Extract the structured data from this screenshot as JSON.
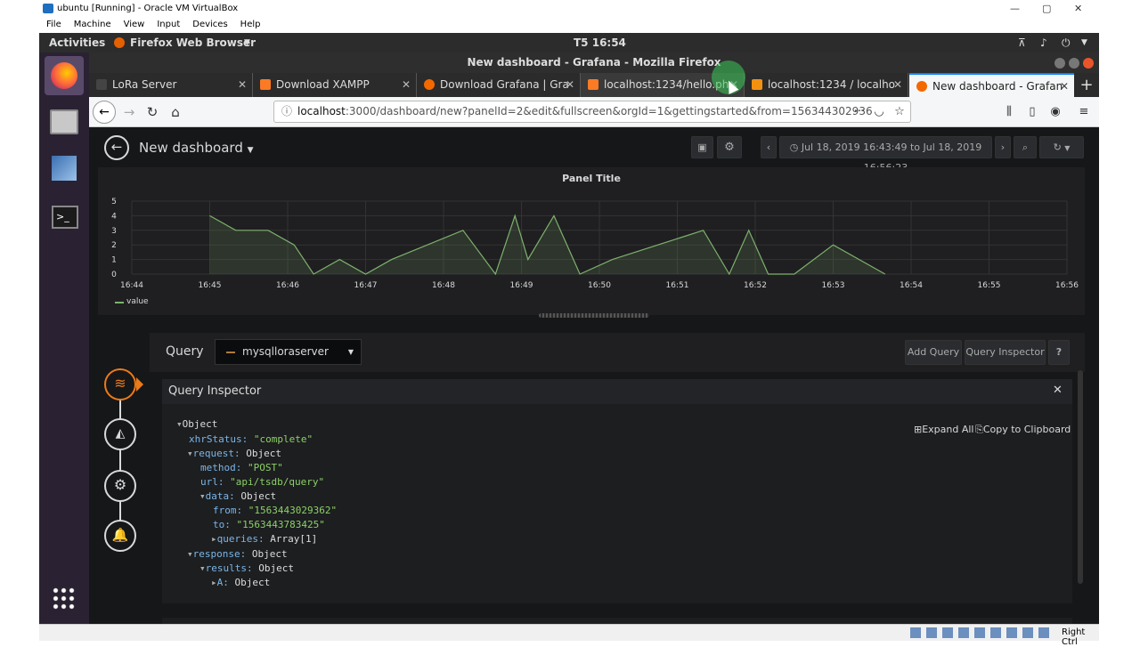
{
  "vbox": {
    "title": "ubuntu [Running] - Oracle VM VirtualBox",
    "menu": [
      "File",
      "Machine",
      "View",
      "Input",
      "Devices",
      "Help"
    ],
    "status_right": "Right Ctrl"
  },
  "ubuntu_bar": {
    "activities": "Activities",
    "app": "Firefox Web Browser",
    "clock": "T5 16:54"
  },
  "firefox": {
    "window_title": "New dashboard - Grafana - Mozilla Firefox",
    "tabs": [
      {
        "label": "LoRa Server"
      },
      {
        "label": "Download XAMPP"
      },
      {
        "label": "Download Grafana | Gra"
      },
      {
        "label": "localhost:1234/hello.ph"
      },
      {
        "label": "localhost:1234 / localho"
      },
      {
        "label": "New dashboard - Grafan"
      }
    ],
    "url_host": "localhost",
    "url_rest": ":3000/dashboard/new?panelId=2&edit&fullscreen&orgId=1&gettingstarted&from=156344302936"
  },
  "grafana": {
    "dashboard_title": "New dashboard",
    "time_range": "Jul 18, 2019 16:43:49 to Jul 18, 2019 16:56:23",
    "query_label": "Query",
    "datasource": "mysqlloraserver",
    "add_query": "Add Query",
    "query_inspector_btn": "Query Inspector",
    "help": "?",
    "inspector_title": "Query Inspector",
    "expand_all": "Expand All",
    "copy_clipboard": "Copy to Clipboard",
    "json": {
      "l1": "Object",
      "xhr_k": "xhrStatus:",
      "xhr_v": "\"complete\"",
      "req_k": "request:",
      "req_v": "Object",
      "method_k": "method:",
      "method_v": "\"POST\"",
      "url_k": "url:",
      "url_v": "\"api/tsdb/query\"",
      "data_k": "data:",
      "data_v": "Object",
      "from_k": "from:",
      "from_v": "\"1563443029362\"",
      "to_k": "to:",
      "to_v": "\"1563443783425\"",
      "queries_k": "queries:",
      "queries_v": "Array[1]",
      "resp_k": "response:",
      "resp_v": "Object",
      "results_k": "results:",
      "results_v": "Object",
      "a_k": "A:",
      "a_v": "Object"
    }
  },
  "chart_data": {
    "type": "area",
    "title": "Panel Title",
    "x_ticks": [
      "16:44",
      "16:45",
      "16:46",
      "16:47",
      "16:48",
      "16:49",
      "16:50",
      "16:51",
      "16:52",
      "16:53",
      "16:54",
      "16:55",
      "16:56"
    ],
    "y_ticks": [
      0,
      1,
      2,
      3,
      4,
      5
    ],
    "ylim": [
      0,
      5
    ],
    "series": [
      {
        "name": "value",
        "color": "#7eb26d",
        "x": [
          "16:45:00",
          "16:45:20",
          "16:45:45",
          "16:46:05",
          "16:46:20",
          "16:46:40",
          "16:47:00",
          "16:47:20",
          "16:48:15",
          "16:48:40",
          "16:48:55",
          "16:49:05",
          "16:49:25",
          "16:49:45",
          "16:50:10",
          "16:51:20",
          "16:51:40",
          "16:51:55",
          "16:52:10",
          "16:52:30",
          "16:53:00",
          "16:53:20",
          "16:53:40"
        ],
        "values": [
          4,
          3,
          3,
          2,
          0,
          1,
          0,
          1,
          3,
          0,
          4,
          1,
          4,
          0,
          1,
          3,
          0,
          3,
          0,
          0,
          2,
          1,
          0
        ]
      }
    ],
    "grid": true,
    "legend": "bottom-left"
  },
  "colors": {
    "grafana_bg": "#161719",
    "panel_bg": "#1f1f21",
    "accent": "#eb7b18",
    "series": "#7eb26d"
  }
}
